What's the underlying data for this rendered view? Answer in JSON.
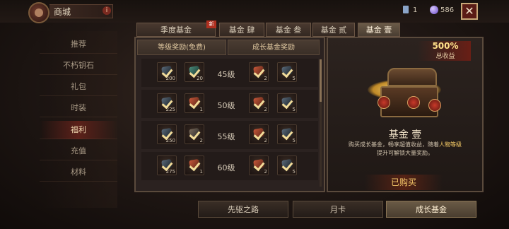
{
  "header": {
    "title": "商城",
    "info_mark": "i",
    "currency_book": "1",
    "currency_orb": "586",
    "close_label": "✕"
  },
  "sidebar": {
    "items": [
      {
        "label": "推荐"
      },
      {
        "label": "不朽钥石"
      },
      {
        "label": "礼包"
      },
      {
        "label": "时装"
      },
      {
        "label": "福利",
        "active": true
      },
      {
        "label": "充值"
      },
      {
        "label": "材料"
      }
    ]
  },
  "tabs": [
    {
      "label": "季度基金"
    },
    {
      "label": "基金 肆"
    },
    {
      "label": "基金 叁"
    },
    {
      "label": "基金 贰"
    },
    {
      "label": "基金 壹",
      "active": true
    }
  ],
  "tab_new_badge": "新",
  "columns": {
    "left": "等级奖励(免费)",
    "right": "成长基金奖励"
  },
  "rows": [
    {
      "level": "45级",
      "free": [
        "200",
        "20"
      ],
      "paid": [
        "2",
        "5"
      ]
    },
    {
      "level": "50级",
      "free": [
        "225",
        "1"
      ],
      "paid": [
        "2",
        "5"
      ]
    },
    {
      "level": "55级",
      "free": [
        "250",
        "2"
      ],
      "paid": [
        "2",
        "5"
      ]
    },
    {
      "level": "60级",
      "free": [
        "275",
        "1"
      ],
      "paid": [
        "2",
        "5"
      ]
    }
  ],
  "promo": {
    "percent": "500%",
    "percent_label": "总收益",
    "fund_title": "基金 壹",
    "desc_part1": "购买成长基金，畅享超值收益，随着",
    "desc_highlight": "人物等级",
    "desc_part2": "提升可解锁大量奖励。",
    "bought_label": "已购买"
  },
  "bottom_tabs": [
    {
      "label": "先驱之路"
    },
    {
      "label": "月卡"
    },
    {
      "label": "成长基金",
      "active": true
    }
  ],
  "colors": {
    "accent_gold": "#ffe08a",
    "active_red": "#8c281e"
  }
}
